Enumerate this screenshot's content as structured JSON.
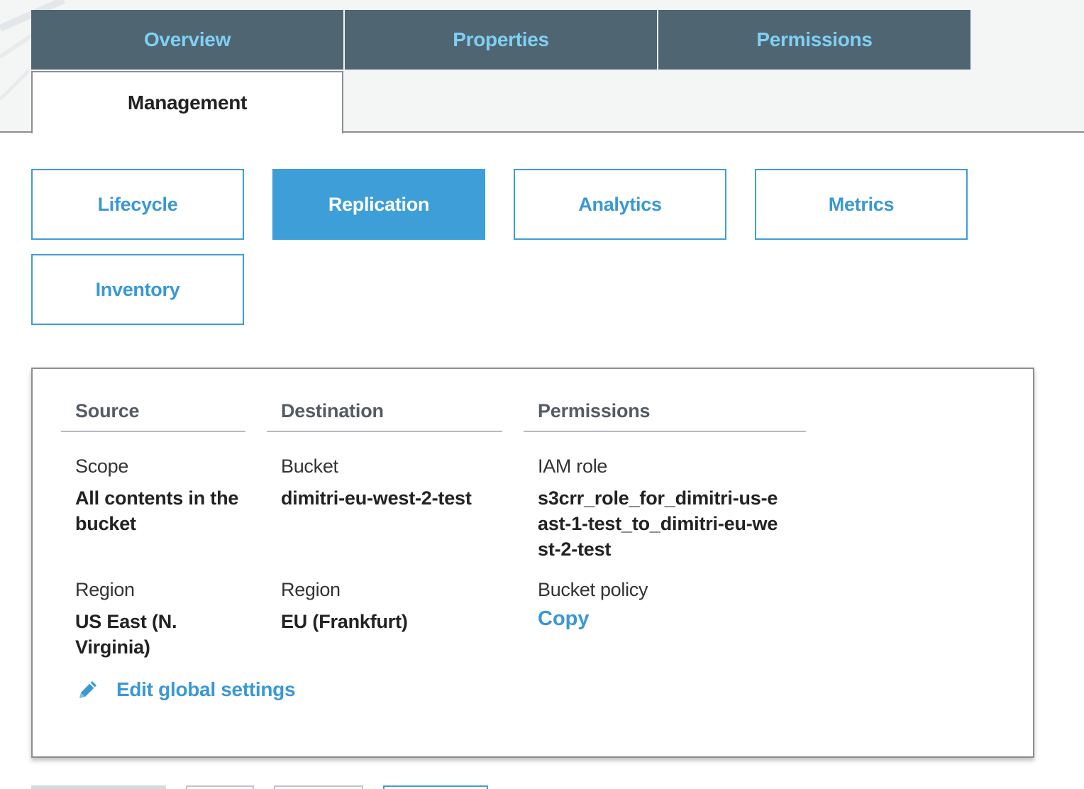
{
  "tabs": {
    "overview": "Overview",
    "properties": "Properties",
    "permissions": "Permissions",
    "management": "Management"
  },
  "subtabs": {
    "lifecycle": "Lifecycle",
    "replication": "Replication",
    "analytics": "Analytics",
    "metrics": "Metrics",
    "inventory": "Inventory"
  },
  "replication": {
    "source": {
      "heading": "Source",
      "scope_label": "Scope",
      "scope_value": "All contents in the bucket",
      "region_label": "Region",
      "region_value": "US East (N. Virginia)"
    },
    "destination": {
      "heading": "Destination",
      "bucket_label": "Bucket",
      "bucket_value": "dimitri-eu-west-2-test",
      "region_label": "Region",
      "region_value": "EU (Frankfurt)"
    },
    "permissions": {
      "heading": "Permissions",
      "iam_label": "IAM role",
      "iam_value": "s3crr_role_for_dimitri-us-east-1-test_to_dimitri-eu-west-2-test",
      "policy_label": "Bucket policy",
      "policy_link": "Copy"
    },
    "edit_link": "Edit global settings"
  },
  "colors": {
    "tab_bg": "#4f6572",
    "tab_text": "#7fd0f4",
    "accent": "#3d9ed8",
    "link": "#3a98d3"
  },
  "icons": {
    "edit": "pencil-icon"
  }
}
